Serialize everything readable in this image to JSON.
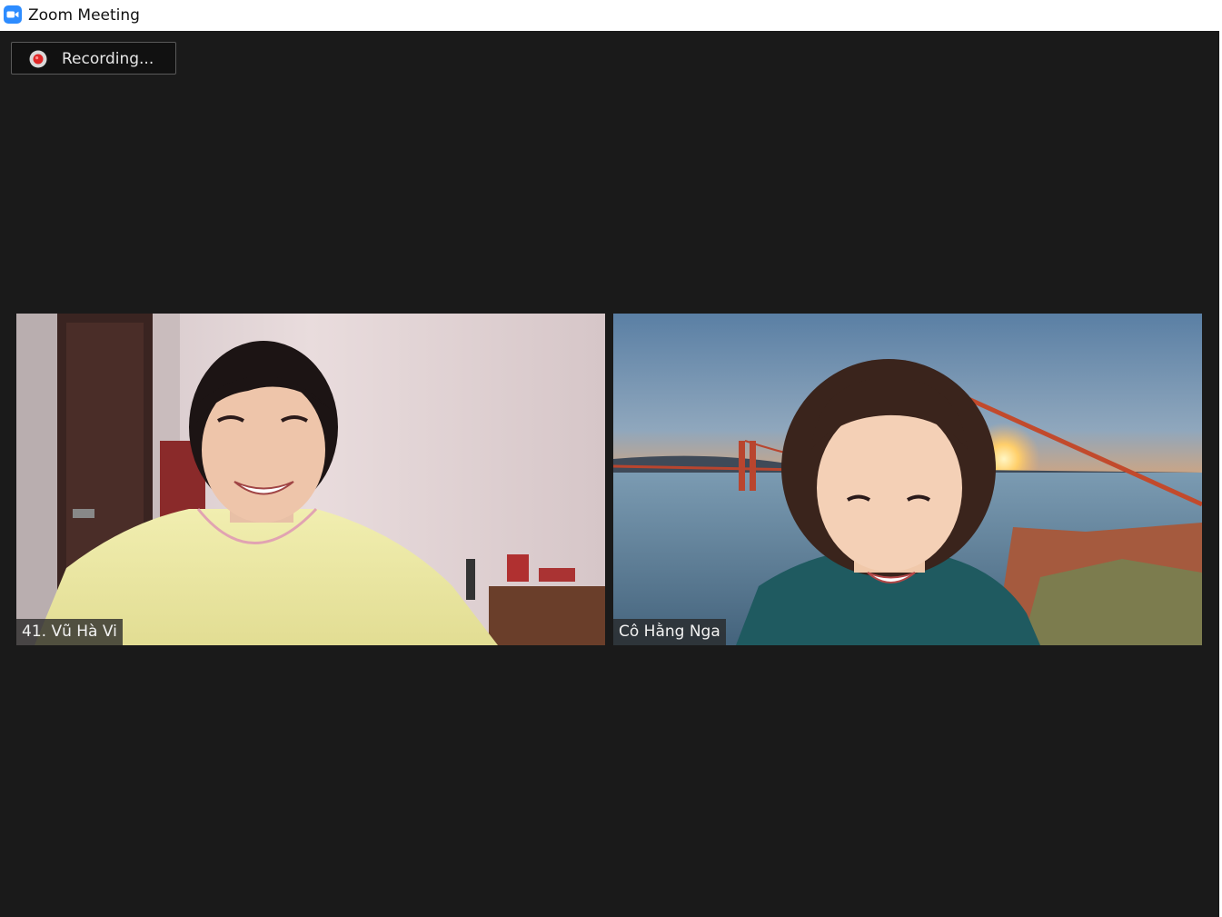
{
  "window": {
    "title": "Zoom Meeting",
    "app_icon": "zoom-camera-icon",
    "brand_color": "#2D8CFF"
  },
  "recording": {
    "label": "Recording...",
    "icon": "record-dot-icon",
    "indicator_color": "#E02828"
  },
  "participants": [
    {
      "name": "41. Vũ Hà Vi"
    },
    {
      "name": "Cô Hằng Nga"
    }
  ],
  "colors": {
    "stage_background": "#1A1A1A",
    "titlebar_background": "#FFFFFF"
  }
}
